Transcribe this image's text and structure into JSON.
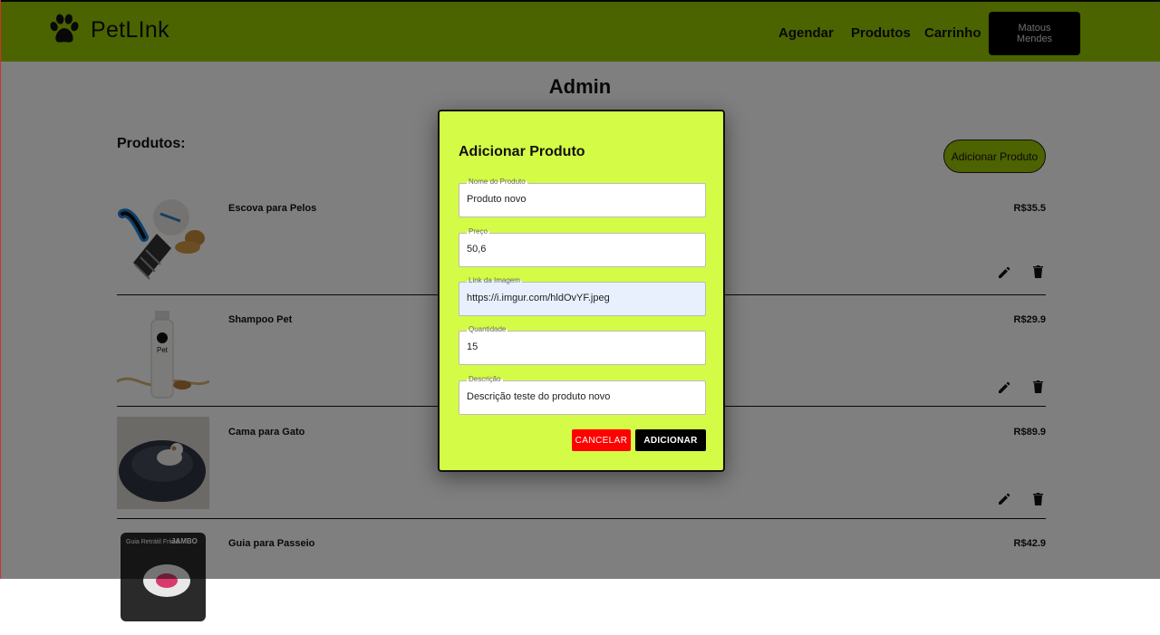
{
  "header": {
    "brand": "PetLInk",
    "nav": [
      "Agendar",
      "Produtos",
      "Carrinho"
    ],
    "user_name": "Matous Mendes",
    "accent_color": "#97c800"
  },
  "page": {
    "title": "Admin",
    "section_title": "Produtos:",
    "add_button_label": "Adicionar Produto"
  },
  "products": [
    {
      "name": "Escova para Pelos",
      "price": "R$35.5",
      "image": "brush-image"
    },
    {
      "name": "Shampoo Pet",
      "price": "R$29.9",
      "image": "shampoo-image"
    },
    {
      "name": "Cama para Gato",
      "price": "R$89.9",
      "image": "cat-bed-image"
    },
    {
      "name": "Guia para Passeio",
      "price": "R$42.9",
      "image": "leash-image"
    }
  ],
  "product_images": {
    "shampoo_label": "Pet",
    "leash_label_left": "Guia Retrátil Frimd",
    "leash_label_right": "JAMBO"
  },
  "modal": {
    "title": "Adicionar Produto",
    "background_color": "#d4fb45",
    "fields": [
      {
        "label": "Nome do Produto",
        "value": "Produto novo"
      },
      {
        "label": "Preço",
        "value": "50,6"
      },
      {
        "label": "Link da Imagem",
        "value": "https://i.imgur.com/hldOvYF.jpeg"
      },
      {
        "label": "Quantidade",
        "value": "15"
      },
      {
        "label": "Descrição",
        "value": "Descrição teste do produto novo"
      }
    ],
    "cancel_label": "CANCELAR",
    "submit_label": "ADICIONAR",
    "cancel_color": "#ff0000",
    "submit_color": "#000000"
  }
}
